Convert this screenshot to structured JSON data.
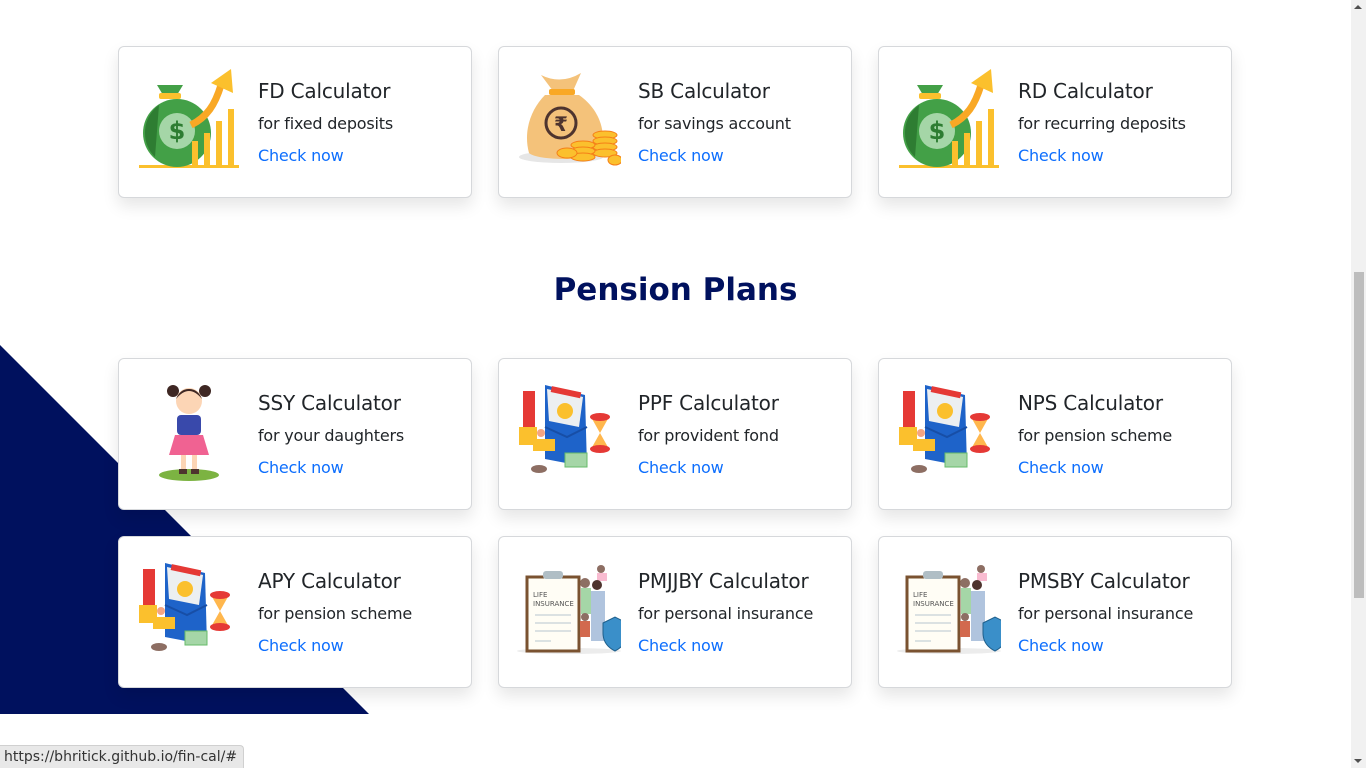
{
  "top_calculators": [
    {
      "title": "FD Calculator",
      "subtitle": "for fixed deposits",
      "link": "Check now",
      "icon": "money-bag-growth-icon"
    },
    {
      "title": "SB Calculator",
      "subtitle": "for savings account",
      "link": "Check now",
      "icon": "rupee-bag-coins-icon"
    },
    {
      "title": "RD Calculator",
      "subtitle": "for recurring deposits",
      "link": "Check now",
      "icon": "money-bag-growth-icon"
    }
  ],
  "pension_section": {
    "heading": "Pension Plans",
    "calculators": [
      {
        "title": "SSY Calculator",
        "subtitle": "for your daughters",
        "link": "Check now",
        "icon": "girl-illustration-icon"
      },
      {
        "title": "PPF Calculator",
        "subtitle": "for provident fond",
        "link": "Check now",
        "icon": "pension-envelope-icon"
      },
      {
        "title": "NPS Calculator",
        "subtitle": "for pension scheme",
        "link": "Check now",
        "icon": "pension-envelope-icon"
      },
      {
        "title": "APY Calculator",
        "subtitle": "for pension scheme",
        "link": "Check now",
        "icon": "pension-envelope-icon"
      },
      {
        "title": "PMJJBY Calculator",
        "subtitle": "for personal insurance",
        "link": "Check now",
        "icon": "life-insurance-family-icon"
      },
      {
        "title": "PMSBY Calculator",
        "subtitle": "for personal insurance",
        "link": "Check now",
        "icon": "life-insurance-family-icon"
      }
    ]
  },
  "icon_labels": {
    "insurance_doc": "LIFE INSURANCE"
  },
  "status_bar": {
    "url": "https://bhritick.github.io/fin-cal/#"
  },
  "colors": {
    "accent_navy": "#00115e",
    "link_blue": "#0d6efd",
    "text": "#212529"
  }
}
